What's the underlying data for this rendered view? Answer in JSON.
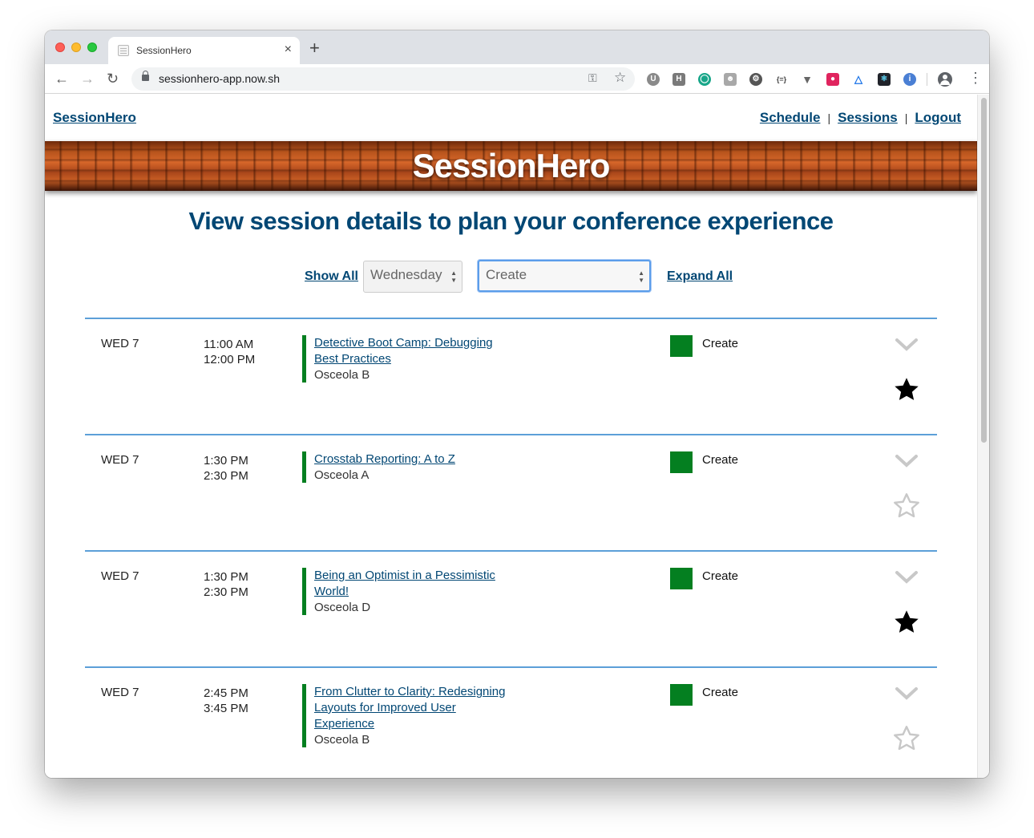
{
  "browser": {
    "tab_title": "SessionHero",
    "url": "sessionhero-app.now.sh",
    "new_tab": "+",
    "close_tab": "×"
  },
  "header": {
    "brand": "SessionHero",
    "nav": [
      "Schedule",
      "Sessions",
      "Logout"
    ],
    "separator": "|"
  },
  "banner": {
    "title": "SessionHero"
  },
  "main": {
    "headline": "View session details to plan your conference experience"
  },
  "filters": {
    "show_all": "Show All",
    "day_select": "Wednesday",
    "track_select": "Create",
    "expand_all": "Expand All"
  },
  "sessions": [
    {
      "day": "WED 7",
      "start": "11:00 AM",
      "end": "12:00 PM",
      "title": "Detective Boot Camp: Debugging Best Practices",
      "room": "Osceola B",
      "track": "Create",
      "track_color": "#047f20",
      "starred": true
    },
    {
      "day": "WED 7",
      "start": "1:30 PM",
      "end": "2:30 PM",
      "title": "Crosstab Reporting: A to Z",
      "room": "Osceola A",
      "track": "Create",
      "track_color": "#047f20",
      "starred": false
    },
    {
      "day": "WED 7",
      "start": "1:30 PM",
      "end": "2:30 PM",
      "title": "Being an Optimist in a Pessimistic World!",
      "room": "Osceola D",
      "track": "Create",
      "track_color": "#047f20",
      "starred": true
    },
    {
      "day": "WED 7",
      "start": "2:45 PM",
      "end": "3:45 PM",
      "title": "From Clutter to Clarity: Redesigning Layouts for Improved User Experience",
      "room": "Osceola B",
      "track": "Create",
      "track_color": "#047f20",
      "starred": false
    }
  ],
  "colors": {
    "link": "#024774",
    "divider": "#5c9fd8",
    "track_create": "#047f20"
  }
}
